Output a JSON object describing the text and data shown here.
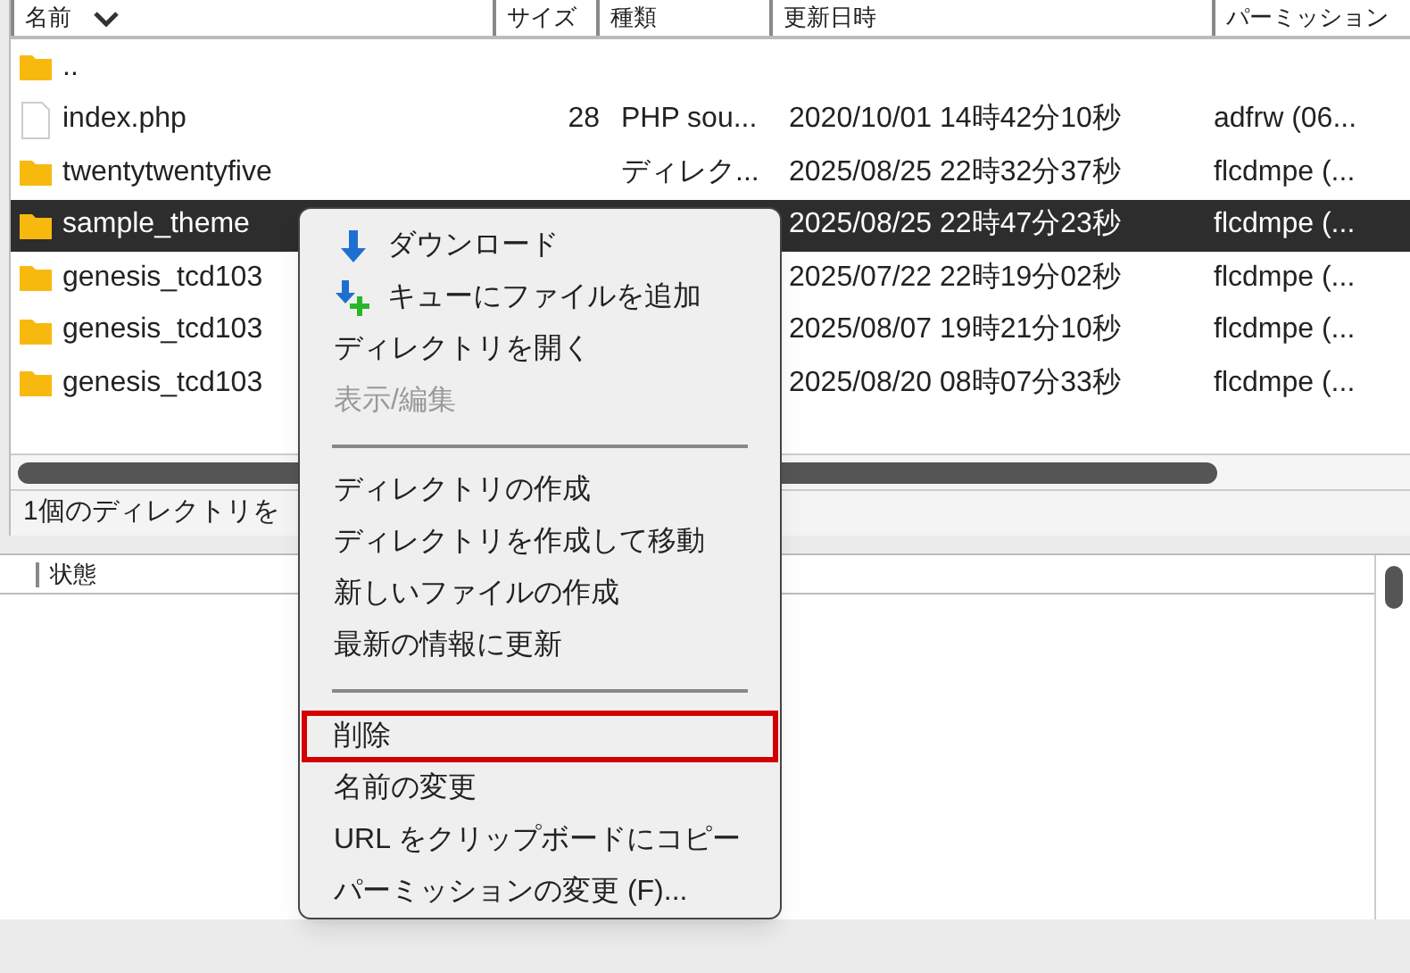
{
  "file_list": {
    "columns": [
      {
        "label": "名前"
      },
      {
        "label": "サイズ"
      },
      {
        "label": "種類"
      },
      {
        "label": "更新日時"
      },
      {
        "label": "パーミッション"
      }
    ],
    "rows": [
      {
        "kind": "folder",
        "name": "..",
        "selected": false
      },
      {
        "kind": "file",
        "name": "index.php",
        "size": "28",
        "type": "PHP sou...",
        "modified": "2020/10/01 14時42分10秒",
        "permissions": "adfrw (06...",
        "selected": false
      },
      {
        "kind": "folder",
        "name": "twentytwentyfive",
        "type": "ディレク...",
        "modified": "2025/08/25 22時32分37秒",
        "permissions": "flcdmpe (...",
        "selected": false
      },
      {
        "kind": "folder",
        "name": "sample_theme",
        "modified": "2025/08/25 22時47分23秒",
        "permissions": "flcdmpe (...",
        "selected": true
      },
      {
        "kind": "folder",
        "name": "genesis_tcd103",
        "modified": "2025/07/22 22時19分02秒",
        "permissions": "flcdmpe (...",
        "selected": false
      },
      {
        "kind": "folder",
        "name": "genesis_tcd103",
        "modified": "2025/08/07 19時21分10秒",
        "permissions": "flcdmpe (...",
        "selected": false
      },
      {
        "kind": "folder",
        "name": "genesis_tcd103",
        "modified": "2025/08/20 08時07分33秒",
        "permissions": "flcdmpe (...",
        "selected": false
      }
    ],
    "status": "1個のディレクトリを"
  },
  "queue_panel": {
    "columns": [
      {
        "label": "状態"
      }
    ]
  },
  "context_menu": {
    "items": [
      {
        "kind": "download",
        "label": "ダウンロード",
        "disabled": false,
        "highlighted": false
      },
      {
        "kind": "queue",
        "label": "キューにファイルを追加",
        "disabled": false,
        "highlighted": false
      },
      {
        "kind": "item",
        "label": "ディレクトリを開く",
        "disabled": false,
        "highlighted": false
      },
      {
        "kind": "item",
        "label": "表示/編集",
        "disabled": true,
        "highlighted": false
      },
      {
        "kind": "separator"
      },
      {
        "kind": "item",
        "label": "ディレクトリの作成",
        "disabled": false,
        "highlighted": false
      },
      {
        "kind": "item",
        "label": "ディレクトリを作成して移動",
        "disabled": false,
        "highlighted": false
      },
      {
        "kind": "item",
        "label": "新しいファイルの作成",
        "disabled": false,
        "highlighted": false
      },
      {
        "kind": "item",
        "label": "最新の情報に更新",
        "disabled": false,
        "highlighted": false
      },
      {
        "kind": "separator"
      },
      {
        "kind": "item",
        "label": "削除",
        "disabled": false,
        "highlighted": true
      },
      {
        "kind": "item",
        "label": "名前の変更",
        "disabled": false,
        "highlighted": false
      },
      {
        "kind": "item",
        "label": "URL をクリップボードにコピー",
        "disabled": false,
        "highlighted": false
      },
      {
        "kind": "item",
        "label": "パーミッションの変更 (F)...",
        "disabled": false,
        "highlighted": false
      }
    ]
  }
}
